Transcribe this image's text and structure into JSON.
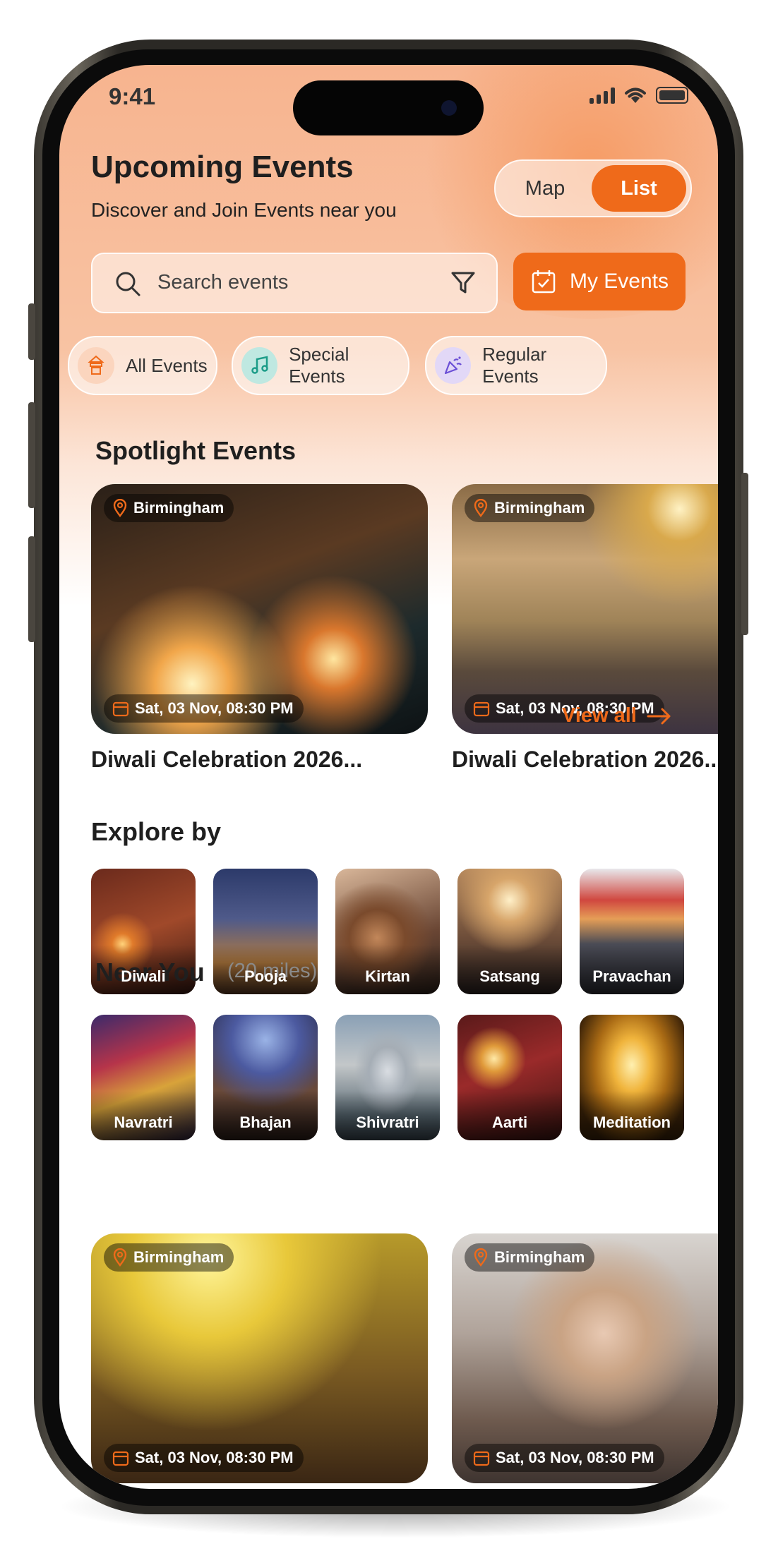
{
  "status_bar": {
    "time": "9:41"
  },
  "header": {
    "title": "Upcoming Events",
    "subtitle": "Discover and Join Events near you"
  },
  "view_toggle": {
    "map_label": "Map",
    "list_label": "List",
    "selected": "List"
  },
  "search": {
    "placeholder": "Search events"
  },
  "my_events": {
    "label": "My Events"
  },
  "categories": [
    {
      "label": "All Events",
      "icon": "temple-icon"
    },
    {
      "label": "Special Events",
      "icon": "music-note-icon"
    },
    {
      "label": "Regular Events",
      "icon": "party-popper-icon"
    }
  ],
  "spotlight": {
    "title": "Spotlight Events",
    "events": [
      {
        "location": "Birmingham",
        "datetime": "Sat, 03 Nov, 08:30 PM",
        "title": "Diwali Celebration 2026..."
      },
      {
        "location": "Birmingham",
        "datetime": "Sat, 03 Nov, 08:30 PM",
        "title": "Diwali Celebration 2026..."
      }
    ]
  },
  "explore": {
    "title": "Explore by",
    "view_all": "View all",
    "tiles": [
      "Diwali",
      "Pooja",
      "Kirtan",
      "Satsang",
      "Pravachan",
      "Navratri",
      "Bhajan",
      "Shivratri",
      "Aarti",
      "Meditation"
    ]
  },
  "near_you": {
    "title": "Near You",
    "radius": "(20 miles)",
    "events": [
      {
        "location": "Birmingham",
        "datetime": "Sat, 03 Nov, 08:30 PM"
      },
      {
        "location": "Birmingham",
        "datetime": "Sat, 03 Nov, 08:30 PM"
      }
    ]
  },
  "colors": {
    "accent": "#ef6a1a",
    "text": "#1f1f1f"
  }
}
